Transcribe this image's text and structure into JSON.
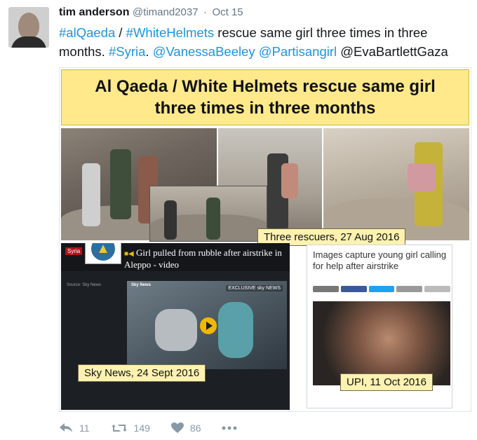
{
  "tweet": {
    "author_name": "tim anderson",
    "handle": "@timand2037",
    "separator": "·",
    "date": "Oct 15",
    "text": {
      "hashtag_alqaeda": "#alQaeda",
      "slash": " / ",
      "hashtag_whitehelmets": "#WhiteHelmets",
      "body_line1": " rescue same girl three times in three",
      "body_line2": "months. ",
      "hashtag_syria": "#Syria",
      "mention_vanessa": "@VanessaBeeley",
      "mention_partisan": "@Partisangirl",
      "mention_eva": "@EvaBartlettGaza"
    }
  },
  "media": {
    "banner_line1": "Al Qaeda / White Helmets rescue same girl",
    "banner_line2": "three times in three months",
    "tag_aug": "Three rescuers, 27 Aug 2016",
    "tag_sky": "Sky News, 24 Sept 2016",
    "tag_upi": "UPI, 11 Oct 2016",
    "sky": {
      "section": "Syria",
      "headline": "Girl pulled from rubble after airstrike in Aleppo - video",
      "source": "Source: Sky News",
      "video_label": "Sky News",
      "exclusive": "EXCLUSIVE sky NEWS"
    },
    "upi": {
      "title": "Images capture young girl calling for help after airstrike"
    }
  },
  "actions": {
    "reply_count": "11",
    "retweet_count": "149",
    "like_count": "86"
  },
  "colors": {
    "link": "#1b95e0",
    "banner": "#ffe98a",
    "tag": "#fff2b0",
    "action_icon": "#8899a6"
  }
}
